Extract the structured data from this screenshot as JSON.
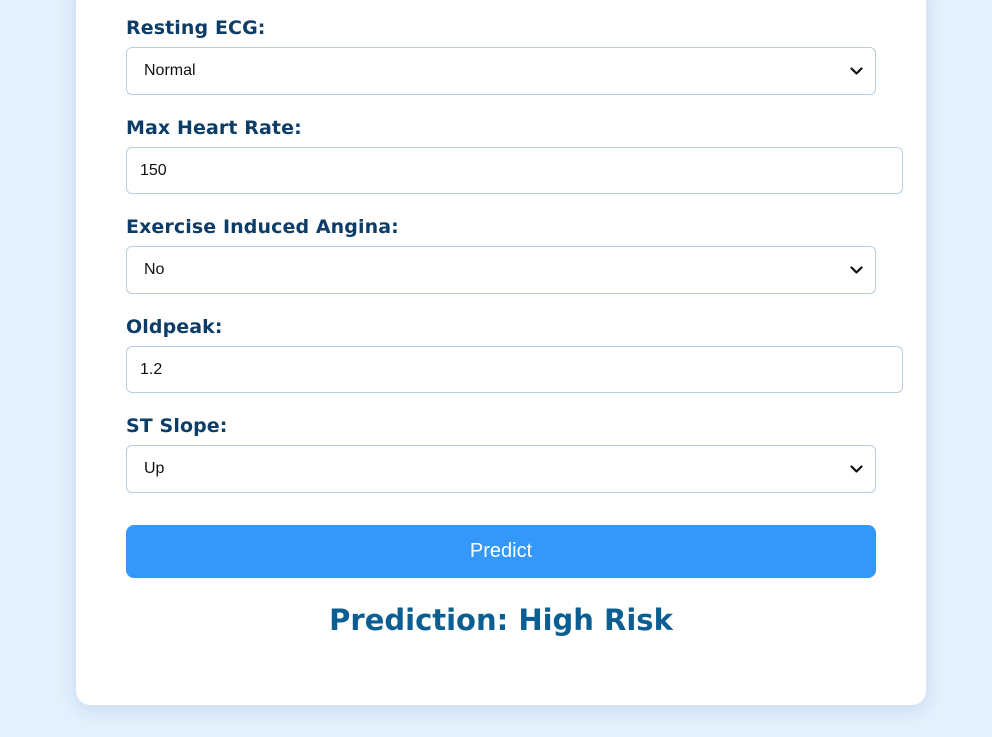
{
  "form": {
    "resting_ecg": {
      "label": "Resting ECG:",
      "value": "Normal"
    },
    "max_heart_rate": {
      "label": "Max Heart Rate:",
      "value": "150"
    },
    "exercise_angina": {
      "label": "Exercise Induced Angina:",
      "value": "No"
    },
    "oldpeak": {
      "label": "Oldpeak:",
      "value": "1.2"
    },
    "st_slope": {
      "label": "ST Slope:",
      "value": "Up"
    }
  },
  "predict_button": {
    "label": "Predict"
  },
  "result": {
    "text": "Prediction: High Risk"
  },
  "colors": {
    "background": "#e3f0fd",
    "label": "#0d3d66",
    "button": "#3498fb",
    "result": "#0a5e92"
  },
  "icons": {
    "dropdown": "chevron-down-icon"
  }
}
